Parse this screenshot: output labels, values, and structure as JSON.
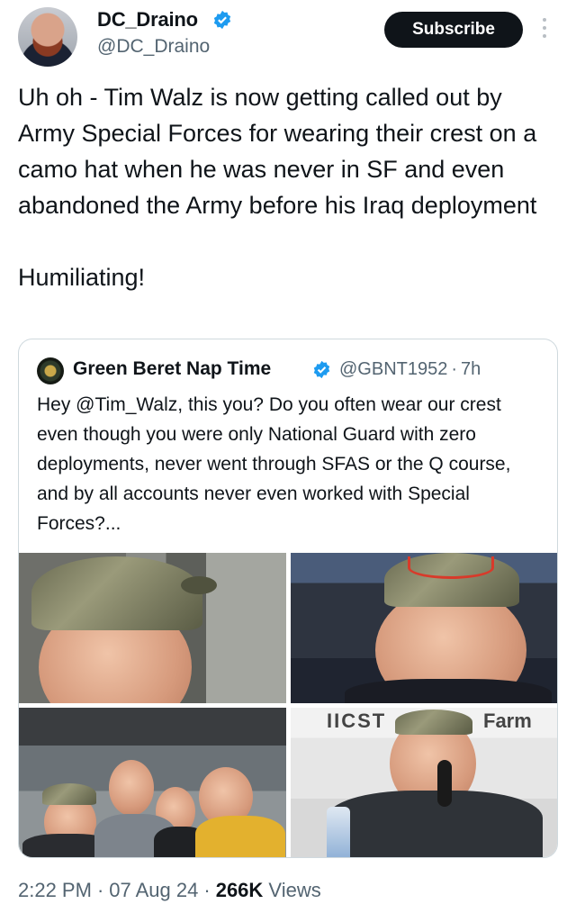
{
  "author": {
    "name": "DC_Draino",
    "handle": "@DC_Draino",
    "verified_color": "#1d9bf0"
  },
  "header": {
    "subscribe_label": "Subscribe",
    "more_icon": "more-vertical-icon"
  },
  "tweet": {
    "text": "Uh oh - Tim Walz is now getting called out by Army Special Forces for wearing their crest on a camo hat when he was never in SF and even abandoned the Army before his Iraq deployment\n\nHumiliating!"
  },
  "quote": {
    "name": "Green Beret Nap Time",
    "handle": "@GBNT1952",
    "separator": "·",
    "time": "7h",
    "text": "Hey @Tim_Walz, this you? Do you often wear our crest even though you were only National Guard with zero deployments, never went through SFAS or the Q course, and by all accounts never even worked with Special Forces?...",
    "photo_signs": {
      "top": "IICST",
      "farm": "Farm"
    }
  },
  "footer": {
    "time": "2:22 PM",
    "date": "07 Aug 24",
    "separator": "·",
    "views_count": "266K",
    "views_label": "Views"
  }
}
